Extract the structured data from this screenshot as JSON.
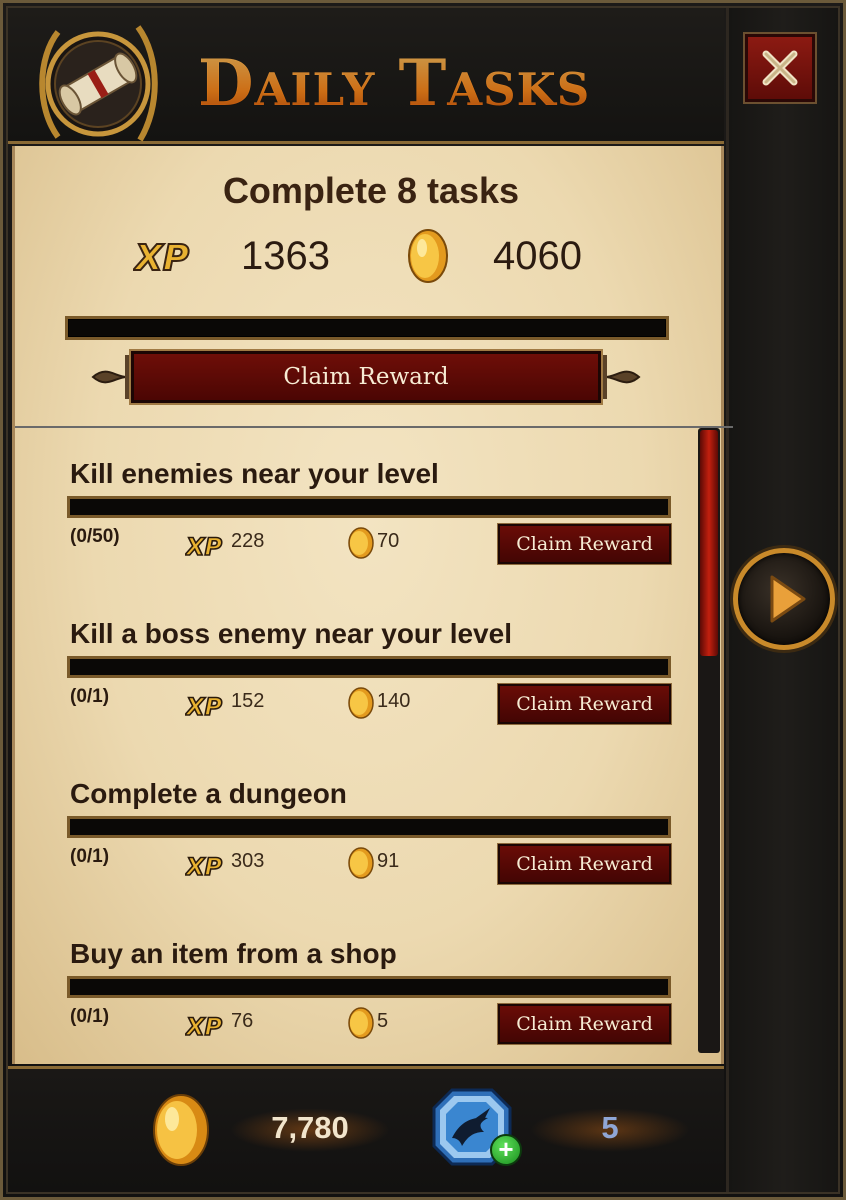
{
  "header": {
    "title": "Daily Tasks"
  },
  "summary": {
    "title": "Complete 8 tasks",
    "xp_label": "XP",
    "xp": "1363",
    "gold": "4060",
    "progress": 0,
    "claim_label": "Claim Reward"
  },
  "tasks": [
    {
      "name": "Kill enemies near your level",
      "progress": "(0/50)",
      "xp_label": "XP",
      "xp": "228",
      "gold": "70",
      "claim_label": "Claim Reward"
    },
    {
      "name": "Kill a boss enemy near your level",
      "progress": "(0/1)",
      "xp_label": "XP",
      "xp": "152",
      "gold": "140",
      "claim_label": "Claim Reward"
    },
    {
      "name": "Complete a dungeon",
      "progress": "(0/1)",
      "xp_label": "XP",
      "xp": "303",
      "gold": "91",
      "claim_label": "Claim Reward"
    },
    {
      "name": "Buy an item from a shop",
      "progress": "(0/1)",
      "xp_label": "XP",
      "xp": "76",
      "gold": "5",
      "claim_label": "Claim Reward"
    }
  ],
  "footer": {
    "gold": "7,780",
    "gems": "5",
    "gem_plus": "+"
  },
  "colors": {
    "accent_gold": "#c98a2a",
    "button_red": "#6a0c07",
    "parchment": "#ecd9b0",
    "title_orange": "#ff8a1c"
  },
  "icons": {
    "emblem": "scroll-emblem-icon",
    "close": "close-x-icon",
    "next": "play-arrow-icon",
    "gold": "gold-coin-icon",
    "gem": "dragon-gem-icon",
    "xp": "xp-icon"
  }
}
